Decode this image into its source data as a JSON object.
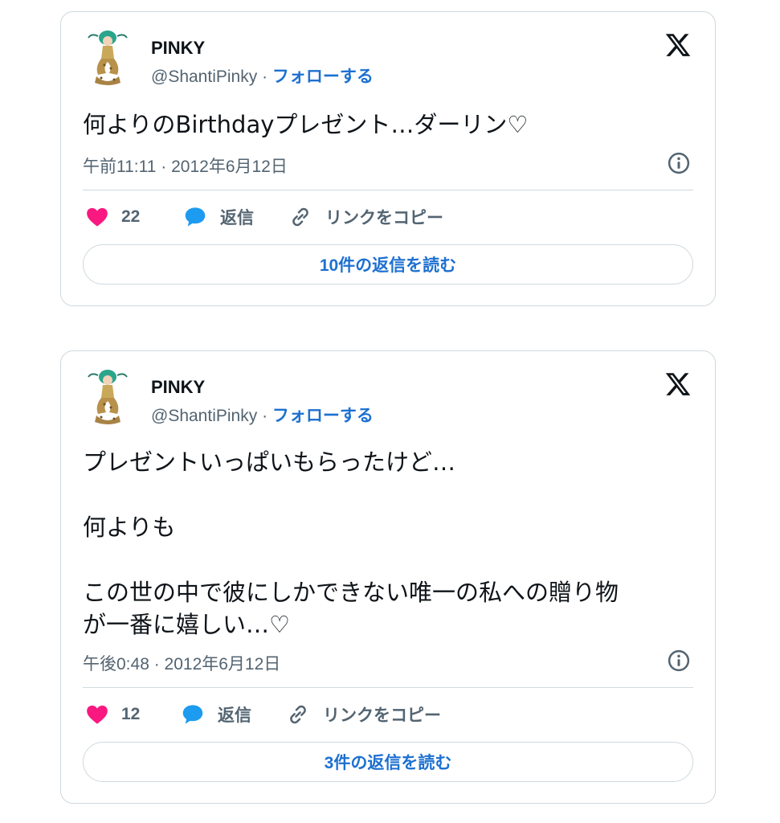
{
  "tweets": [
    {
      "author_name": "PINKY",
      "handle": "@ShantiPinky",
      "separator": "·",
      "follow_label": "フォローする",
      "text_lines": [
        "何よりのBirthdayプレゼント…ダーリン♡"
      ],
      "timestamp": "午前11:11 · 2012年6月12日",
      "likes": "22",
      "reply_label": "返信",
      "copy_link_label": "リンクをコピー",
      "read_replies_label": "10件の返信を読む"
    },
    {
      "author_name": "PINKY",
      "handle": "@ShantiPinky",
      "separator": "·",
      "follow_label": "フォローする",
      "text_lines": [
        "プレゼントいっぱいもらったけど…",
        "",
        "何よりも",
        "",
        "この世の中で彼にしかできない唯一の私への贈り物",
        "が一番に嬉しい…♡"
      ],
      "timestamp": "午後0:48 · 2012年6月12日",
      "likes": "12",
      "reply_label": "返信",
      "copy_link_label": "リンクをコピー",
      "read_replies_label": "3件の返信を読む"
    }
  ],
  "icons": {
    "brand": "x-logo-icon",
    "info": "info-icon",
    "like": "heart-icon",
    "reply": "speech-bubble-icon",
    "copy": "link-icon"
  },
  "colors": {
    "link_blue": "#1d70d1",
    "heart_pink": "#f91880",
    "reply_blue": "#1d9bf0",
    "muted_text": "#536471",
    "border": "#cfd9de"
  }
}
